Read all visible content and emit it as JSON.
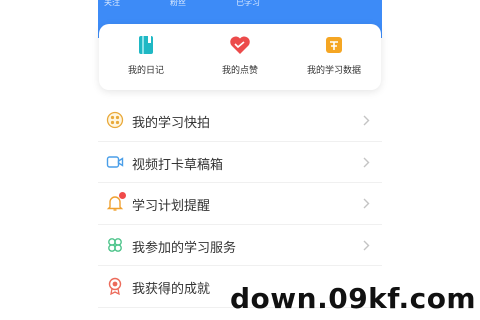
{
  "header": {
    "tabs": [
      "关注",
      "粉丝",
      "已学习"
    ],
    "background": "#3d8bf7"
  },
  "shortcuts": [
    {
      "label": "我的日记",
      "icon": "diary-icon",
      "color": "#1fb8c4"
    },
    {
      "label": "我的点赞",
      "icon": "heart-like-icon",
      "color": "#ec4b4b"
    },
    {
      "label": "我的学习数据",
      "icon": "study-data-icon",
      "color": "#f5a623"
    }
  ],
  "menu": {
    "items": [
      {
        "label": "我的学习快拍",
        "icon": "film-reel-icon"
      },
      {
        "label": "视频打卡草稿箱",
        "icon": "video-camera-icon"
      },
      {
        "label": "学习计划提醒",
        "icon": "bell-icon",
        "badge": "red-dot"
      },
      {
        "label": "我参加的学习服务",
        "icon": "clover-service-icon"
      },
      {
        "label": "我获得的成就",
        "icon": "medal-icon"
      }
    ]
  },
  "watermark": "down.09kf.com"
}
